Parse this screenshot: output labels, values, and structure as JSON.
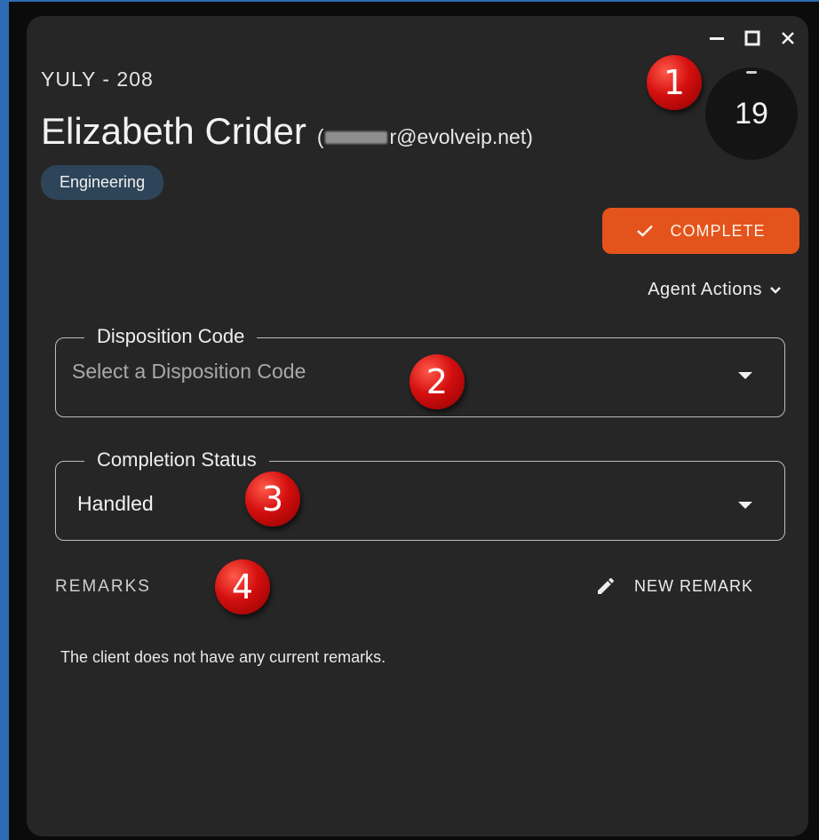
{
  "window_controls": {
    "minimize": "minimize-icon",
    "maximize": "maximize-icon",
    "close": "close-icon"
  },
  "contact": {
    "code": "YULY - 208",
    "name": "Elizabeth Crider",
    "email_open": "(",
    "email_visible": "r@evolveip.net)",
    "department": "Engineering"
  },
  "timer": {
    "value": "19"
  },
  "actions": {
    "complete_label": "COMPLETE",
    "agent_actions_label": "Agent Actions"
  },
  "disposition": {
    "legend": "Disposition Code",
    "placeholder": "Select a Disposition Code"
  },
  "completion_status": {
    "legend": "Completion Status",
    "value": "Handled"
  },
  "remarks": {
    "label": "REMARKS",
    "new_remark_label": "NEW REMARK",
    "empty_message": "The client does not have any current remarks."
  },
  "callouts": [
    "1",
    "2",
    "3",
    "4"
  ],
  "colors": {
    "accent": "#e4531c",
    "panel_background": "#262626",
    "badge_background": "#2e4459",
    "callout_red": "#d40f0f"
  }
}
